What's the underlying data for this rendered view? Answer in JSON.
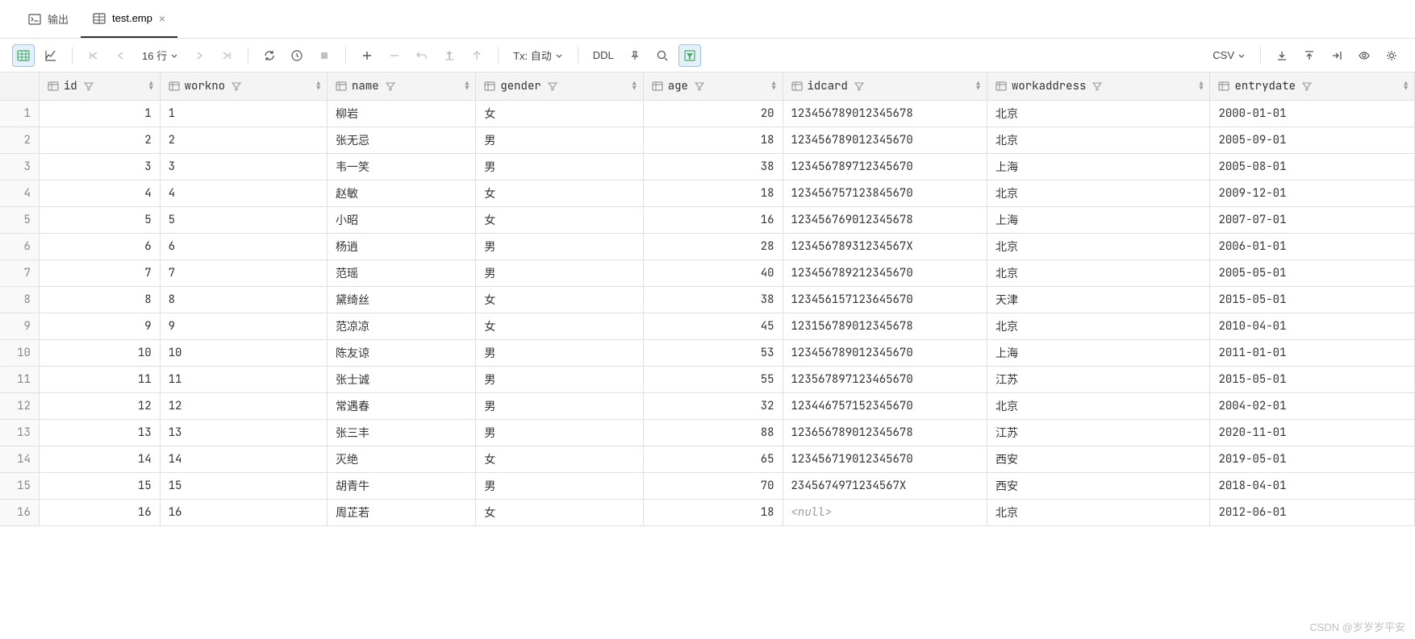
{
  "tabs": [
    {
      "label": "输出",
      "active": false
    },
    {
      "label": "test.emp",
      "active": true
    }
  ],
  "toolbar": {
    "rowcount": "16 行",
    "tx": "Tx: 自动",
    "ddl": "DDL",
    "csv": "CSV"
  },
  "columns": [
    "id",
    "workno",
    "name",
    "gender",
    "age",
    "idcard",
    "workaddress",
    "entrydate"
  ],
  "rows": [
    {
      "n": "1",
      "id": "1",
      "workno": "1",
      "name": "柳岩",
      "gender": "女",
      "age": "20",
      "idcard": "123456789012345678",
      "workaddress": "北京",
      "entrydate": "2000-01-01"
    },
    {
      "n": "2",
      "id": "2",
      "workno": "2",
      "name": "张无忌",
      "gender": "男",
      "age": "18",
      "idcard": "123456789012345670",
      "workaddress": "北京",
      "entrydate": "2005-09-01"
    },
    {
      "n": "3",
      "id": "3",
      "workno": "3",
      "name": "韦一笑",
      "gender": "男",
      "age": "38",
      "idcard": "123456789712345670",
      "workaddress": "上海",
      "entrydate": "2005-08-01"
    },
    {
      "n": "4",
      "id": "4",
      "workno": "4",
      "name": "赵敏",
      "gender": "女",
      "age": "18",
      "idcard": "123456757123845670",
      "workaddress": "北京",
      "entrydate": "2009-12-01"
    },
    {
      "n": "5",
      "id": "5",
      "workno": "5",
      "name": "小昭",
      "gender": "女",
      "age": "16",
      "idcard": "123456769012345678",
      "workaddress": "上海",
      "entrydate": "2007-07-01"
    },
    {
      "n": "6",
      "id": "6",
      "workno": "6",
      "name": "杨逍",
      "gender": "男",
      "age": "28",
      "idcard": "12345678931234567X",
      "workaddress": "北京",
      "entrydate": "2006-01-01"
    },
    {
      "n": "7",
      "id": "7",
      "workno": "7",
      "name": "范瑶",
      "gender": "男",
      "age": "40",
      "idcard": "123456789212345670",
      "workaddress": "北京",
      "entrydate": "2005-05-01"
    },
    {
      "n": "8",
      "id": "8",
      "workno": "8",
      "name": "黛绮丝",
      "gender": "女",
      "age": "38",
      "idcard": "123456157123645670",
      "workaddress": "天津",
      "entrydate": "2015-05-01"
    },
    {
      "n": "9",
      "id": "9",
      "workno": "9",
      "name": "范凉凉",
      "gender": "女",
      "age": "45",
      "idcard": "123156789012345678",
      "workaddress": "北京",
      "entrydate": "2010-04-01"
    },
    {
      "n": "10",
      "id": "10",
      "workno": "10",
      "name": "陈友谅",
      "gender": "男",
      "age": "53",
      "idcard": "123456789012345670",
      "workaddress": "上海",
      "entrydate": "2011-01-01"
    },
    {
      "n": "11",
      "id": "11",
      "workno": "11",
      "name": "张士诚",
      "gender": "男",
      "age": "55",
      "idcard": "123567897123465670",
      "workaddress": "江苏",
      "entrydate": "2015-05-01"
    },
    {
      "n": "12",
      "id": "12",
      "workno": "12",
      "name": "常遇春",
      "gender": "男",
      "age": "32",
      "idcard": "123446757152345670",
      "workaddress": "北京",
      "entrydate": "2004-02-01"
    },
    {
      "n": "13",
      "id": "13",
      "workno": "13",
      "name": "张三丰",
      "gender": "男",
      "age": "88",
      "idcard": "123656789012345678",
      "workaddress": "江苏",
      "entrydate": "2020-11-01"
    },
    {
      "n": "14",
      "id": "14",
      "workno": "14",
      "name": "灭绝",
      "gender": "女",
      "age": "65",
      "idcard": "123456719012345670",
      "workaddress": "西安",
      "entrydate": "2019-05-01"
    },
    {
      "n": "15",
      "id": "15",
      "workno": "15",
      "name": "胡青牛",
      "gender": "男",
      "age": "70",
      "idcard": "2345674971234567X",
      "workaddress": "西安",
      "entrydate": "2018-04-01"
    },
    {
      "n": "16",
      "id": "16",
      "workno": "16",
      "name": "周芷若",
      "gender": "女",
      "age": "18",
      "idcard": "<null>",
      "workaddress": "北京",
      "entrydate": "2012-06-01"
    }
  ],
  "watermark": "CSDN @岁岁岁平安"
}
